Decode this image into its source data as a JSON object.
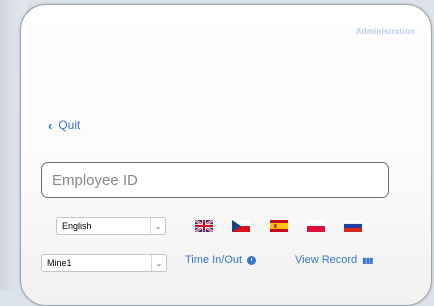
{
  "header": {
    "admin_link": "Administration"
  },
  "quit": {
    "label": "Quit"
  },
  "employee_field": {
    "placeholder": "Employee ID",
    "value": ""
  },
  "language_select": {
    "selected": "English"
  },
  "flags": [
    "united-kingdom-flag",
    "czech-flag",
    "spain-flag",
    "poland-flag",
    "russia-flag"
  ],
  "site_select": {
    "selected": "Mine1"
  },
  "actions": {
    "time_label": "Time In/Out",
    "view_label": "View Record"
  },
  "colors": {
    "accent": "#3a76ca",
    "admin": "#b9cbe6",
    "border": "#6f6f6f"
  }
}
